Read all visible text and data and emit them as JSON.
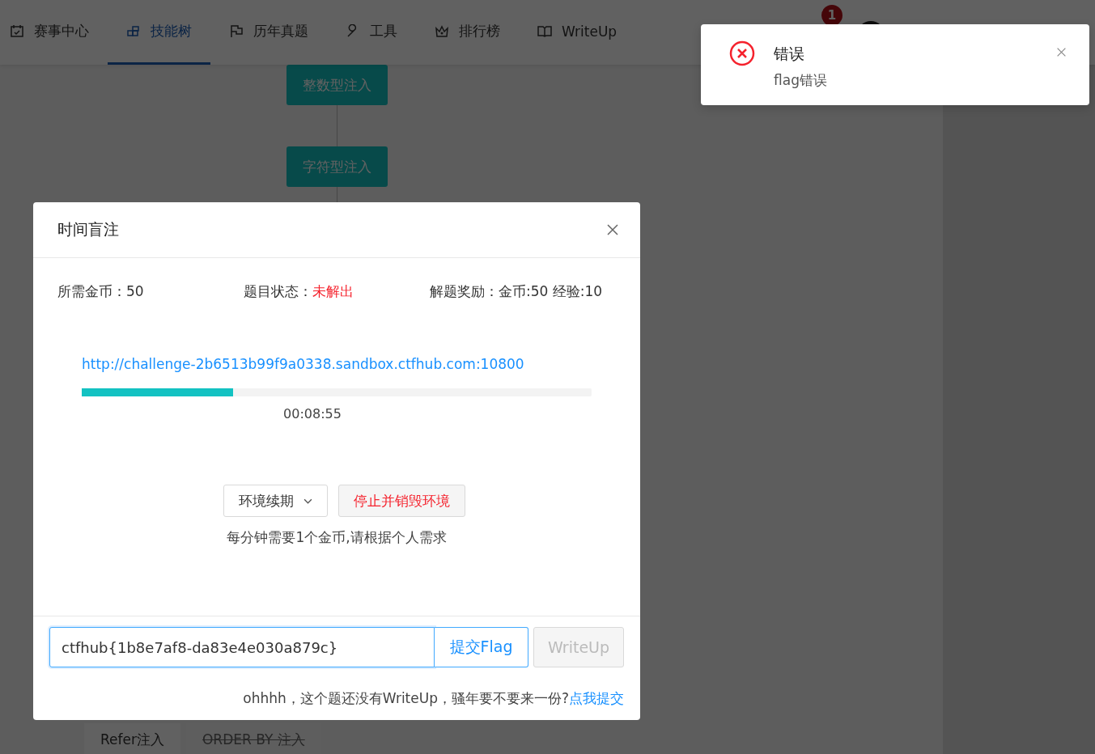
{
  "nav": {
    "items": [
      {
        "label": "赛事中心",
        "selected": false
      },
      {
        "label": "技能树",
        "selected": true
      },
      {
        "label": "历年真题",
        "selected": false
      },
      {
        "label": "工具",
        "selected": false
      },
      {
        "label": "排行榜",
        "selected": false
      },
      {
        "label": "WriteUp",
        "selected": false
      }
    ],
    "badge": "1"
  },
  "tree": {
    "top_nodes": [
      {
        "label": "整数型注入"
      },
      {
        "label": "字符型注入"
      }
    ],
    "bottom_nodes": [
      {
        "label": "Refer注入",
        "struck": false
      },
      {
        "label": "ORDER BY 注入",
        "struck": true
      }
    ]
  },
  "modal": {
    "title": "时间盲注",
    "info": [
      {
        "label": "所需金币：",
        "value": "50",
        "kind": "normal"
      },
      {
        "label": "题目状态：",
        "value": "未解出",
        "kind": "alert"
      },
      {
        "label": "解题奖励：",
        "value": "金币:50 经验:10",
        "kind": "normal"
      }
    ],
    "url": "http://challenge-2b6513b99f9a0338.sandbox.ctfhub.com:10800",
    "progress": {
      "level": 0.297
    },
    "time": "00:08:55",
    "renew_button": "环境续期",
    "stop_button": "停止并销毁环境",
    "note": "每分钟需要1个金币,请根据个人需求",
    "flag_input": {
      "value": "ctfhub{1b8e7af8-da83e4e030a879c}"
    },
    "submit_button": "提交Flag",
    "writeup_button": {
      "label": "WriteUp",
      "disabled": true
    },
    "footer_text": "ohhhh，这个题还没有WriteUp，骚年要不要来一份?",
    "footer_link": "点我提交"
  },
  "notification": {
    "title": "错误",
    "message": "flag错误"
  }
}
